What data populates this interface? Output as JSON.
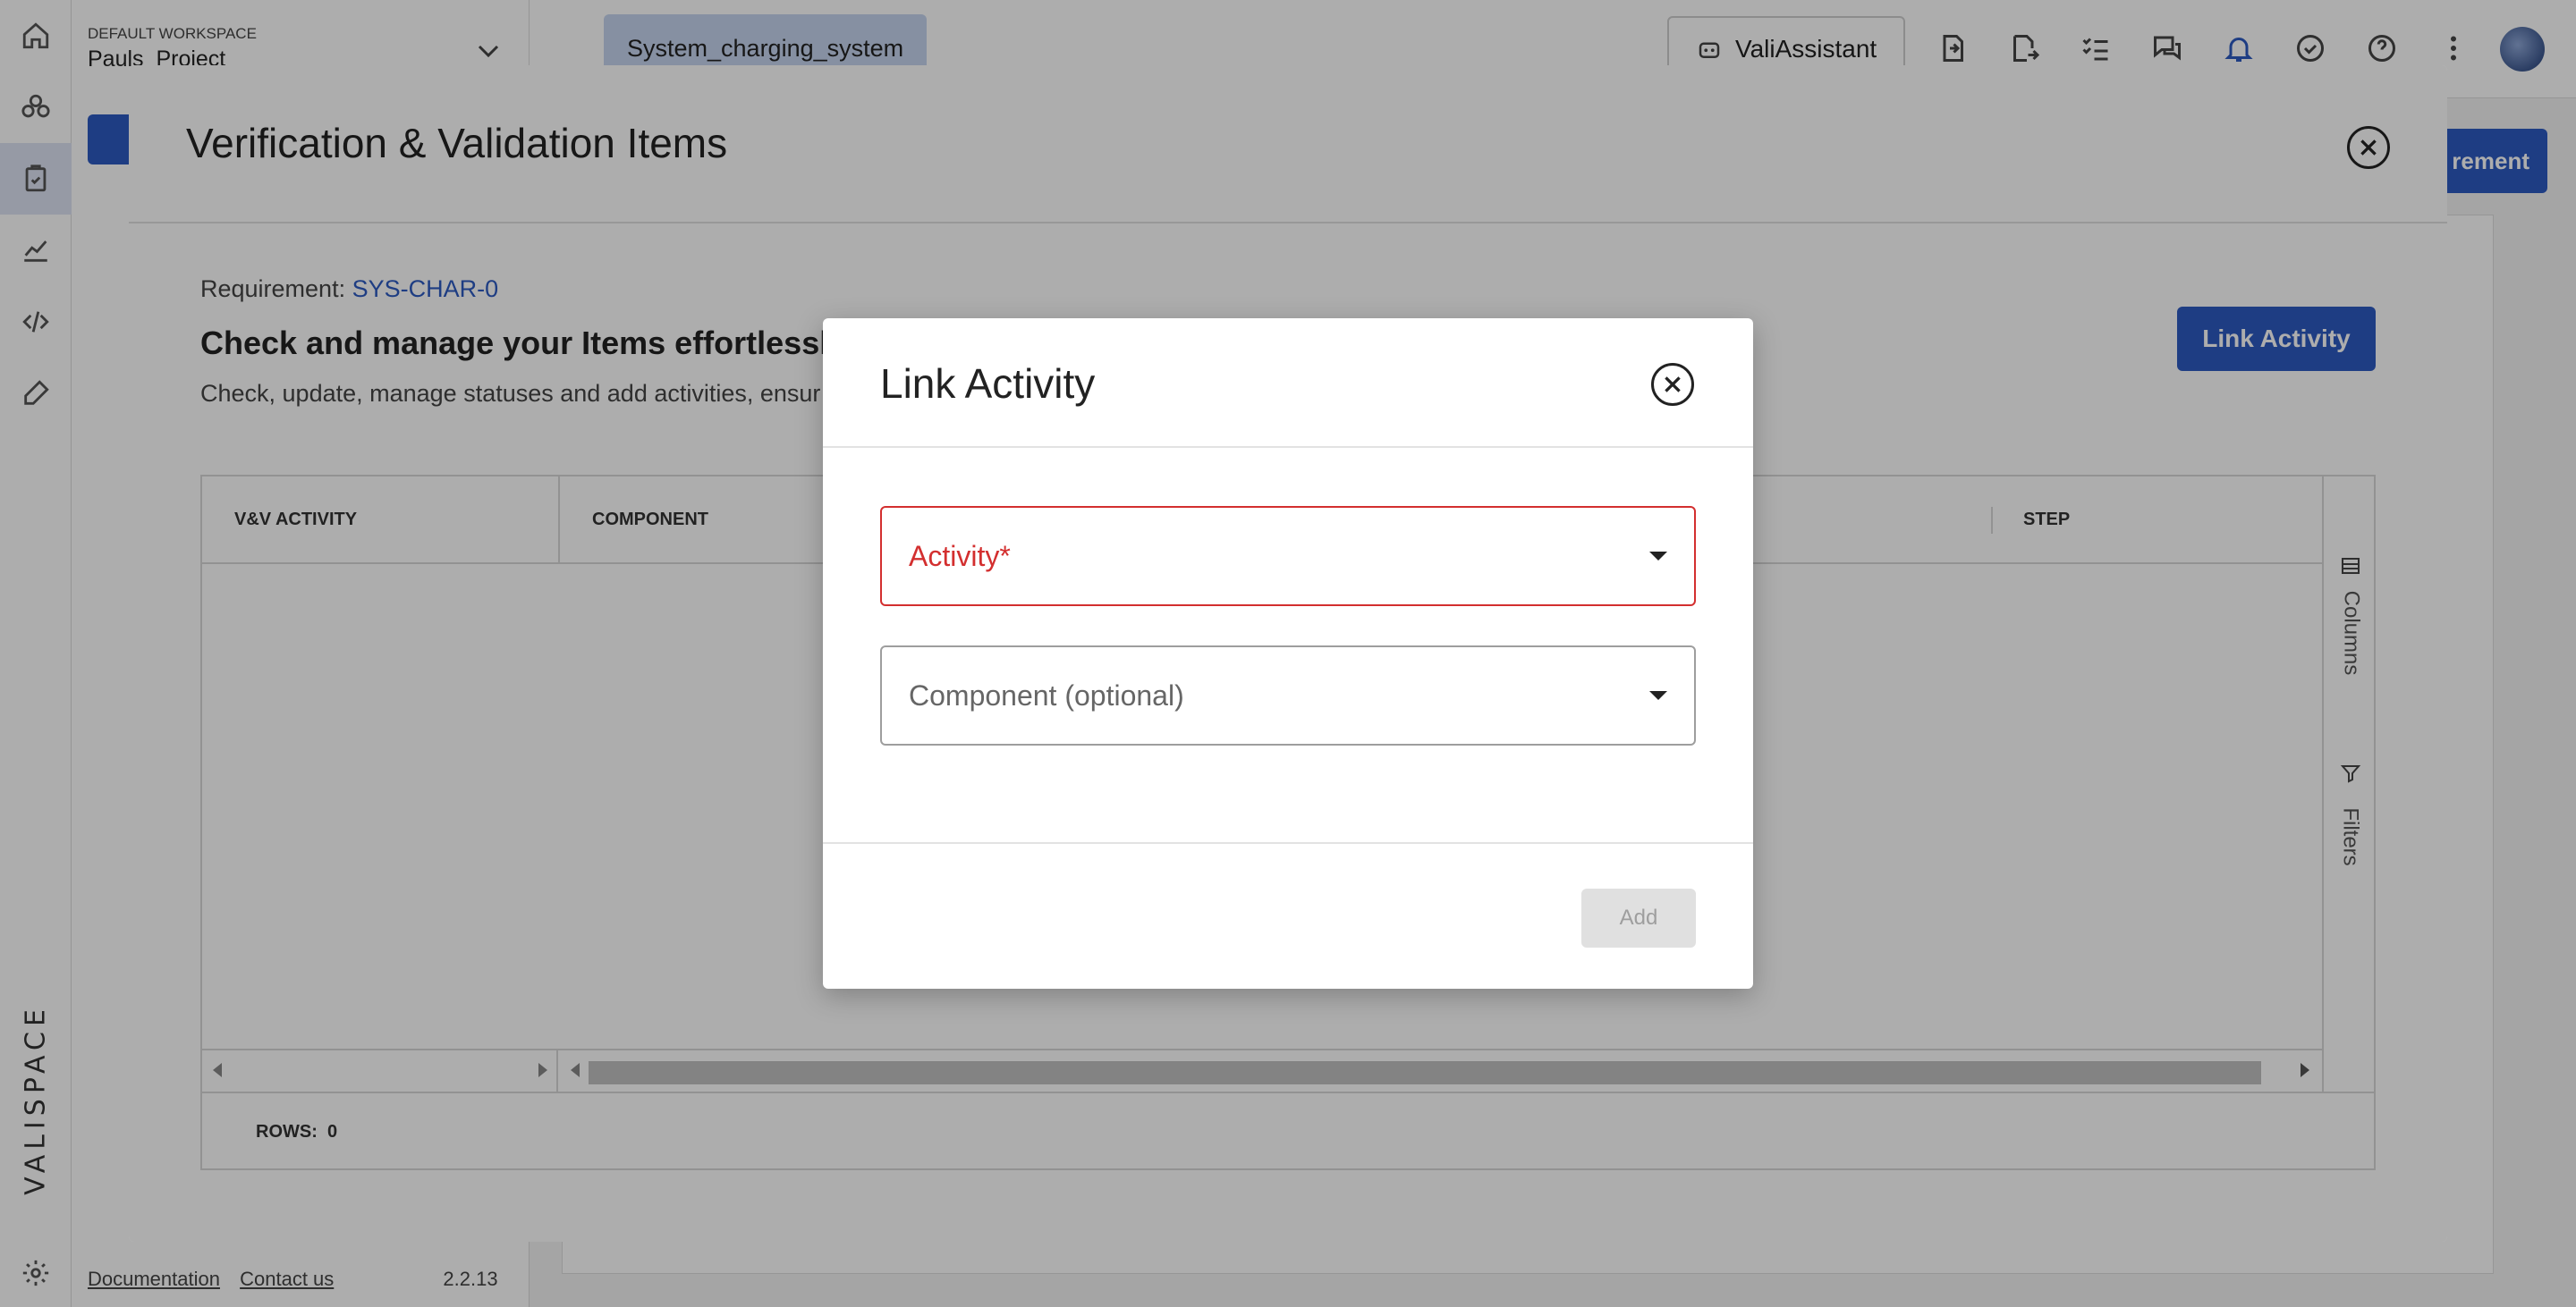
{
  "workspace": {
    "label": "DEFAULT WORKSPACE",
    "project": "Pauls_Project"
  },
  "top_bar": {
    "document_tab": "System_charging_system",
    "assistant_button": "ValiAssistant"
  },
  "background": {
    "right_button_partial": "rement"
  },
  "footer": {
    "documentation": "Documentation",
    "contact": "Contact us",
    "version": "2.2.13"
  },
  "brand": "VALISPACE",
  "vv_modal": {
    "title": "Verification & Validation Items",
    "requirement_label": "Requirement:",
    "requirement_id": "SYS-CHAR-0",
    "heading": "Check and manage your Items effortlessly!",
    "subtext": "Check, update, manage statuses and add activities, ensur",
    "link_activity_button": "Link Activity",
    "grid": {
      "columns": [
        "V&V ACTIVITY",
        "COMPONENT",
        "STEP"
      ],
      "side_panel": {
        "columns": "Columns",
        "filters": "Filters"
      },
      "rows_label": "ROWS:",
      "rows_count": "0"
    }
  },
  "link_modal": {
    "title": "Link Activity",
    "activity_placeholder": "Activity*",
    "component_placeholder": "Component (optional)",
    "add_button": "Add"
  }
}
